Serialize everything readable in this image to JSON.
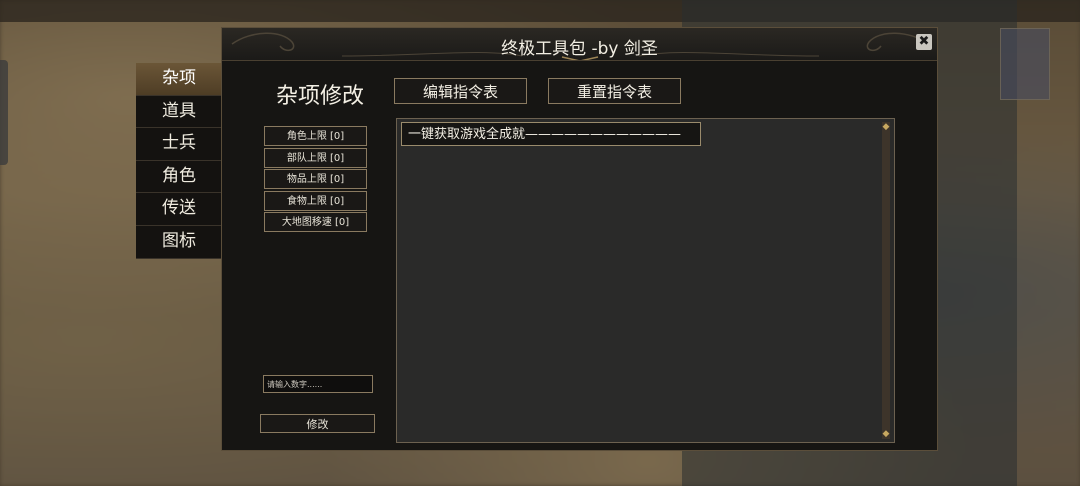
{
  "dialog": {
    "title": "终极工具包 -by 剑圣",
    "close_label": "✖"
  },
  "tabs": [
    {
      "label": "杂项",
      "active": true
    },
    {
      "label": "道具",
      "active": false
    },
    {
      "label": "士兵",
      "active": false
    },
    {
      "label": "角色",
      "active": false
    },
    {
      "label": "传送",
      "active": false
    },
    {
      "label": "图标",
      "active": false
    }
  ],
  "section": {
    "title": "杂项修改",
    "edit_button": "编辑指令表",
    "reset_button": "重置指令表"
  },
  "limits": [
    {
      "label": "角色上限 [0]"
    },
    {
      "label": "部队上限 [0]"
    },
    {
      "label": "物品上限 [0]"
    },
    {
      "label": "食物上限 [0]"
    },
    {
      "label": "大地图移速 [0]"
    }
  ],
  "number_input": {
    "placeholder": "请输入数字......",
    "value": ""
  },
  "modify_button": "修改",
  "commands": [
    {
      "text": "一键获取游戏全成就————————————"
    }
  ],
  "colors": {
    "accent_gold": "#8a7a60",
    "active_tab": "#6b5637",
    "panel_bg": "#2a2a29"
  }
}
